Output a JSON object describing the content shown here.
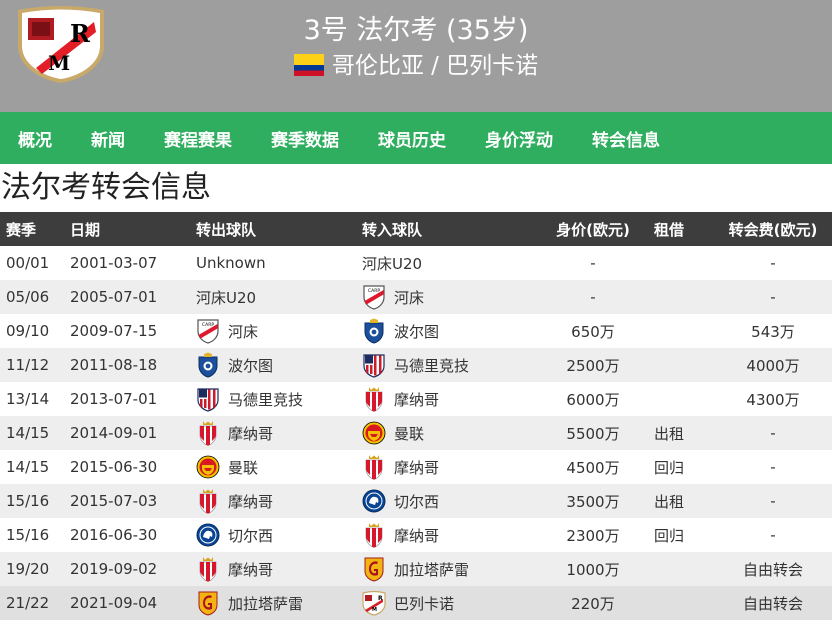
{
  "header": {
    "player_name": "3号 法尔考 (35岁)",
    "player_meta": "哥伦比亚 / 巴列卡诺",
    "club_logo_icon": "rayo-vallecano-crest-icon",
    "flag_icon": "colombia-flag-icon",
    "colors": {
      "background": "#9e9e9e",
      "text": "#ffffff"
    }
  },
  "nav": {
    "items": [
      "概况",
      "新闻",
      "赛程赛果",
      "赛季数据",
      "球员历史",
      "身价浮动",
      "转会信息"
    ],
    "color": "#2fae5f"
  },
  "page_title": "法尔考转会信息",
  "table": {
    "headers": [
      "赛季",
      "日期",
      "转出球队",
      "转入球队",
      "身价(欧元)",
      "租借",
      "转会费(欧元)"
    ],
    "rows": [
      {
        "season": "00/01",
        "date": "2001-03-07",
        "from": "Unknown",
        "from_icon": "",
        "to": "河床U20",
        "to_icon": "",
        "value": "-",
        "loan": "",
        "fee": "-"
      },
      {
        "season": "05/06",
        "date": "2005-07-01",
        "from": "河床U20",
        "from_icon": "",
        "to": "河床",
        "to_icon": "river-plate-crest-icon",
        "value": "-",
        "loan": "",
        "fee": "-"
      },
      {
        "season": "09/10",
        "date": "2009-07-15",
        "from": "河床",
        "from_icon": "river-plate-crest-icon",
        "to": "波尔图",
        "to_icon": "porto-crest-icon",
        "value": "650万",
        "loan": "",
        "fee": "543万"
      },
      {
        "season": "11/12",
        "date": "2011-08-18",
        "from": "波尔图",
        "from_icon": "porto-crest-icon",
        "to": "马德里竞技",
        "to_icon": "atletico-madrid-crest-icon",
        "value": "2500万",
        "loan": "",
        "fee": "4000万"
      },
      {
        "season": "13/14",
        "date": "2013-07-01",
        "from": "马德里竞技",
        "from_icon": "atletico-madrid-crest-icon",
        "to": "摩纳哥",
        "to_icon": "monaco-crest-icon",
        "value": "6000万",
        "loan": "",
        "fee": "4300万"
      },
      {
        "season": "14/15",
        "date": "2014-09-01",
        "from": "摩纳哥",
        "from_icon": "monaco-crest-icon",
        "to": "曼联",
        "to_icon": "manchester-united-crest-icon",
        "value": "5500万",
        "loan": "出租",
        "fee": "-"
      },
      {
        "season": "14/15",
        "date": "2015-06-30",
        "from": "曼联",
        "from_icon": "manchester-united-crest-icon",
        "to": "摩纳哥",
        "to_icon": "monaco-crest-icon",
        "value": "4500万",
        "loan": "回归",
        "fee": "-"
      },
      {
        "season": "15/16",
        "date": "2015-07-03",
        "from": "摩纳哥",
        "from_icon": "monaco-crest-icon",
        "to": "切尔西",
        "to_icon": "chelsea-crest-icon",
        "value": "3500万",
        "loan": "出租",
        "fee": "-"
      },
      {
        "season": "15/16",
        "date": "2016-06-30",
        "from": "切尔西",
        "from_icon": "chelsea-crest-icon",
        "to": "摩纳哥",
        "to_icon": "monaco-crest-icon",
        "value": "2300万",
        "loan": "回归",
        "fee": "-"
      },
      {
        "season": "19/20",
        "date": "2019-09-02",
        "from": "摩纳哥",
        "from_icon": "monaco-crest-icon",
        "to": "加拉塔萨雷",
        "to_icon": "galatasaray-crest-icon",
        "value": "1000万",
        "loan": "",
        "fee": "自由转会"
      },
      {
        "season": "21/22",
        "date": "2021-09-04",
        "from": "加拉塔萨雷",
        "from_icon": "galatasaray-crest-icon",
        "to": "巴列卡诺",
        "to_icon": "rayo-vallecano-crest-icon",
        "value": "220万",
        "loan": "",
        "fee": "自由转会"
      }
    ]
  }
}
